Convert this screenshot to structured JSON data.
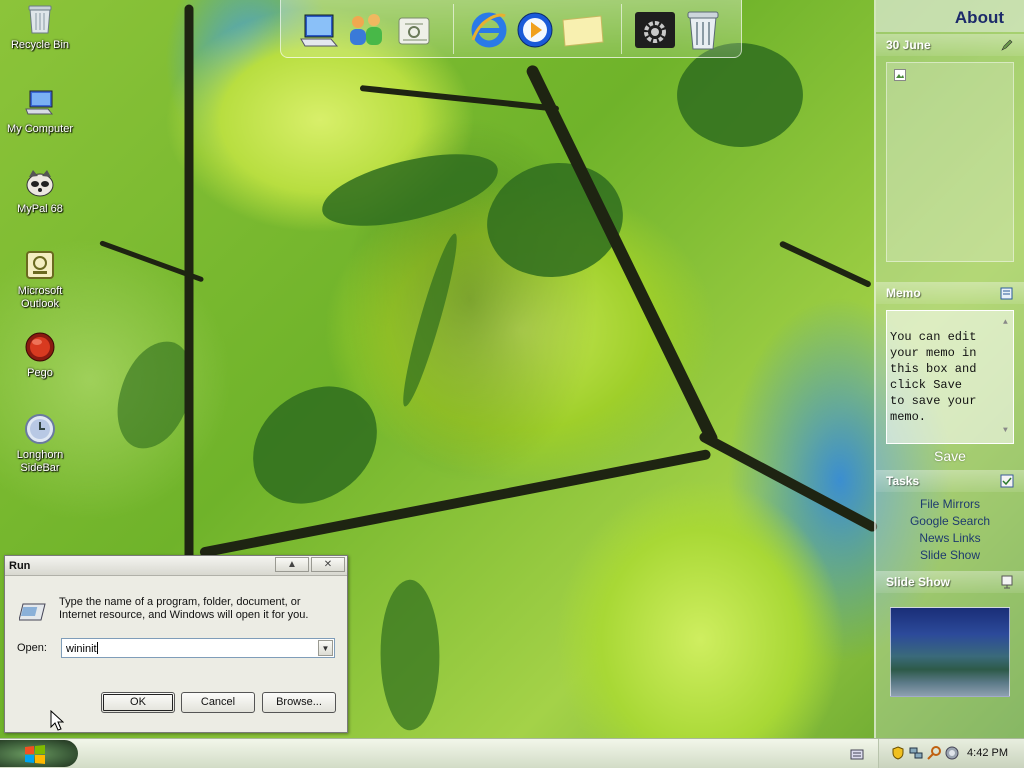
{
  "desktop_icons": [
    {
      "label": "Recycle Bin",
      "icon": "recycle-bin-icon"
    },
    {
      "label": "My Computer",
      "icon": "computer-icon"
    },
    {
      "label": "MyPal 68",
      "icon": "raccoon-icon"
    },
    {
      "label": "Microsoft Outlook",
      "icon": "outlook-icon"
    },
    {
      "label": "Pego",
      "icon": "red-orb-icon"
    },
    {
      "label": "Longhorn SideBar",
      "icon": "sidebar-clock-icon"
    }
  ],
  "dock": {
    "items": [
      "computer-icon",
      "users-icon",
      "mail-icon",
      "ie-icon",
      "media-player-icon",
      "notes-icon",
      "settings-icon",
      "recycle-bin-icon"
    ]
  },
  "sidebar": {
    "title": "About",
    "calendar": {
      "date": "30 June"
    },
    "memo": {
      "heading": "Memo",
      "text": "You can edit\nyour memo in\nthis box and\nclick Save\nto save your\nmemo.",
      "save_label": "Save"
    },
    "tasks": {
      "heading": "Tasks",
      "items": [
        "File Mirrors",
        "Google Search",
        "News Links",
        "Slide Show"
      ]
    },
    "slideshow": {
      "heading": "Slide Show"
    }
  },
  "run_dialog": {
    "title": "Run",
    "description": "Type the name of a program, folder, document, or Internet resource, and Windows will open it for you.",
    "open_label": "Open:",
    "input_value": "wininit",
    "ok_label": "OK",
    "cancel_label": "Cancel",
    "browse_label": "Browse..."
  },
  "taskbar": {
    "clock": "4:42 PM"
  },
  "colors": {
    "sidebar_title": "#1c2a6a",
    "task_link": "#1e3a6e"
  }
}
